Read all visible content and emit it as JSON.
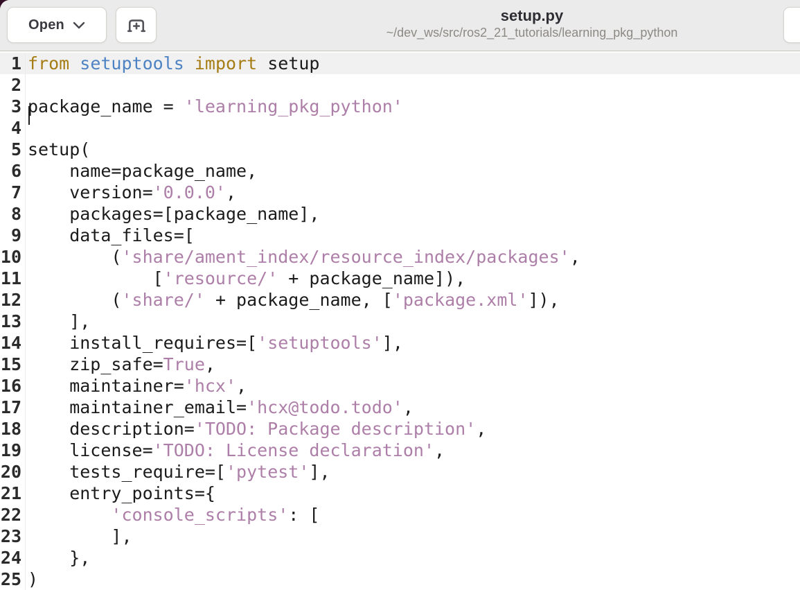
{
  "header": {
    "open_button": {
      "label": "Open",
      "chevron_icon": "chevron-down-icon"
    },
    "new_tab_button": {
      "icon": "tab-new-icon"
    },
    "title": "setup.py",
    "subtitle": "~/dev_ws/src/ros2_21_tutorials/learning_pkg_python"
  },
  "colors": {
    "header_bg": "#ebebeb",
    "corner_backdrop": "#330c26",
    "current_line_bg": "#f1f1f1",
    "syntax_keyword": "#a67d14",
    "syntax_module": "#4d82c3",
    "syntax_string": "#ad7fa8",
    "syntax_boolean": "#ad7fa8",
    "syntax_text": "#1b1b1b"
  },
  "editor": {
    "language": "python",
    "current_line": 1,
    "cursor": {
      "line": 1,
      "col": 1
    },
    "lines": [
      {
        "n": 1,
        "tokens": [
          [
            "k",
            "from"
          ],
          [
            "p",
            " "
          ],
          [
            "m",
            "setuptools"
          ],
          [
            "p",
            " "
          ],
          [
            "k",
            "import"
          ],
          [
            "p",
            " setup"
          ]
        ]
      },
      {
        "n": 2,
        "tokens": []
      },
      {
        "n": 3,
        "tokens": [
          [
            "p",
            "package_name = "
          ],
          [
            "s",
            "'learning_pkg_python'"
          ]
        ]
      },
      {
        "n": 4,
        "tokens": []
      },
      {
        "n": 5,
        "tokens": [
          [
            "p",
            "setup("
          ]
        ]
      },
      {
        "n": 6,
        "tokens": [
          [
            "p",
            "    name=package_name,"
          ]
        ]
      },
      {
        "n": 7,
        "tokens": [
          [
            "p",
            "    version="
          ],
          [
            "s",
            "'0.0.0'"
          ],
          [
            "p",
            ","
          ]
        ]
      },
      {
        "n": 8,
        "tokens": [
          [
            "p",
            "    packages=[package_name],"
          ]
        ]
      },
      {
        "n": 9,
        "tokens": [
          [
            "p",
            "    data_files=["
          ]
        ]
      },
      {
        "n": 10,
        "tokens": [
          [
            "p",
            "        ("
          ],
          [
            "s",
            "'share/ament_index/resource_index/packages'"
          ],
          [
            "p",
            ","
          ]
        ]
      },
      {
        "n": 11,
        "tokens": [
          [
            "p",
            "            ["
          ],
          [
            "s",
            "'resource/'"
          ],
          [
            "p",
            " + package_name]),"
          ]
        ]
      },
      {
        "n": 12,
        "tokens": [
          [
            "p",
            "        ("
          ],
          [
            "s",
            "'share/'"
          ],
          [
            "p",
            " + package_name, ["
          ],
          [
            "s",
            "'package.xml'"
          ],
          [
            "p",
            "]),"
          ]
        ]
      },
      {
        "n": 13,
        "tokens": [
          [
            "p",
            "    ],"
          ]
        ]
      },
      {
        "n": 14,
        "tokens": [
          [
            "p",
            "    install_requires=["
          ],
          [
            "s",
            "'setuptools'"
          ],
          [
            "p",
            "],"
          ]
        ]
      },
      {
        "n": 15,
        "tokens": [
          [
            "p",
            "    zip_safe="
          ],
          [
            "v",
            "True"
          ],
          [
            "p",
            ","
          ]
        ]
      },
      {
        "n": 16,
        "tokens": [
          [
            "p",
            "    maintainer="
          ],
          [
            "s",
            "'hcx'"
          ],
          [
            "p",
            ","
          ]
        ]
      },
      {
        "n": 17,
        "tokens": [
          [
            "p",
            "    maintainer_email="
          ],
          [
            "s",
            "'hcx@todo.todo'"
          ],
          [
            "p",
            ","
          ]
        ]
      },
      {
        "n": 18,
        "tokens": [
          [
            "p",
            "    description="
          ],
          [
            "s",
            "'TODO: Package description'"
          ],
          [
            "p",
            ","
          ]
        ]
      },
      {
        "n": 19,
        "tokens": [
          [
            "p",
            "    license="
          ],
          [
            "s",
            "'TODO: License declaration'"
          ],
          [
            "p",
            ","
          ]
        ]
      },
      {
        "n": 20,
        "tokens": [
          [
            "p",
            "    tests_require=["
          ],
          [
            "s",
            "'pytest'"
          ],
          [
            "p",
            "],"
          ]
        ]
      },
      {
        "n": 21,
        "tokens": [
          [
            "p",
            "    entry_points={"
          ]
        ]
      },
      {
        "n": 22,
        "tokens": [
          [
            "p",
            "        "
          ],
          [
            "s",
            "'console_scripts'"
          ],
          [
            "p",
            ": ["
          ]
        ]
      },
      {
        "n": 23,
        "tokens": [
          [
            "p",
            "        ],"
          ]
        ]
      },
      {
        "n": 24,
        "tokens": [
          [
            "p",
            "    },"
          ]
        ]
      },
      {
        "n": 25,
        "tokens": [
          [
            "p",
            ")"
          ]
        ]
      }
    ]
  }
}
